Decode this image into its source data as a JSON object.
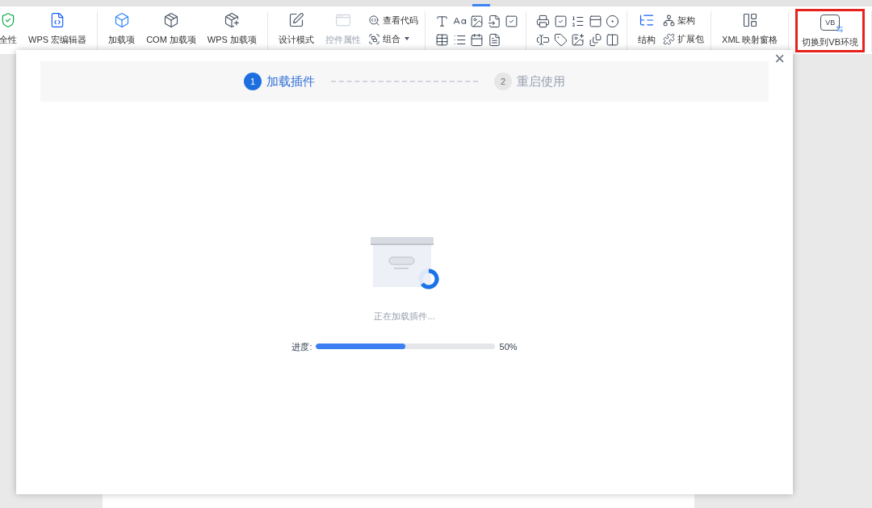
{
  "toolbar": {
    "groups": [
      {
        "items": [
          {
            "kind": "large",
            "label": "全性",
            "disabled": false,
            "highlighted": false
          },
          {
            "kind": "large",
            "label": "WPS 宏编辑器",
            "disabled": false,
            "highlighted": false
          }
        ]
      },
      {
        "items": [
          {
            "kind": "large",
            "label": "加载项",
            "disabled": false,
            "highlighted": false
          },
          {
            "kind": "large",
            "label": "COM 加载项",
            "disabled": false,
            "highlighted": false
          },
          {
            "kind": "large",
            "label": "WPS 加载项",
            "disabled": false,
            "highlighted": false
          }
        ]
      },
      {
        "items": [
          {
            "kind": "large",
            "label": "设计模式",
            "disabled": false,
            "highlighted": false
          },
          {
            "kind": "large",
            "label": "控件属性",
            "disabled": true,
            "highlighted": false
          },
          {
            "kind": "stack",
            "entries": [
              {
                "label": "查看代码",
                "dropdown": false
              },
              {
                "label": "组合",
                "dropdown": true
              }
            ]
          }
        ]
      },
      {
        "items": [
          {
            "kind": "grid"
          }
        ]
      },
      {
        "items": [
          {
            "kind": "grid"
          }
        ]
      },
      {
        "items": [
          {
            "kind": "large",
            "label": "结构",
            "disabled": false,
            "highlighted": false
          },
          {
            "kind": "stack",
            "entries": [
              {
                "label": "架构",
                "dropdown": false
              },
              {
                "label": "扩展包",
                "dropdown": false
              }
            ]
          }
        ]
      },
      {
        "items": [
          {
            "kind": "large",
            "label": "XML 映射窗格",
            "disabled": false,
            "highlighted": false
          }
        ]
      },
      {
        "items": [
          {
            "kind": "large",
            "label": "切换到VB环境",
            "badge": "VB",
            "disabled": false,
            "highlighted": true
          }
        ]
      }
    ]
  },
  "dialog": {
    "close": "×",
    "steps": [
      {
        "number": "1",
        "label": "加载插件",
        "selected": true
      },
      {
        "number": "2",
        "label": "重启使用",
        "selected": false
      }
    ],
    "status": "正在加载插件...",
    "progress": {
      "label": "进度:",
      "level": 0.5,
      "reading": "50%"
    }
  }
}
